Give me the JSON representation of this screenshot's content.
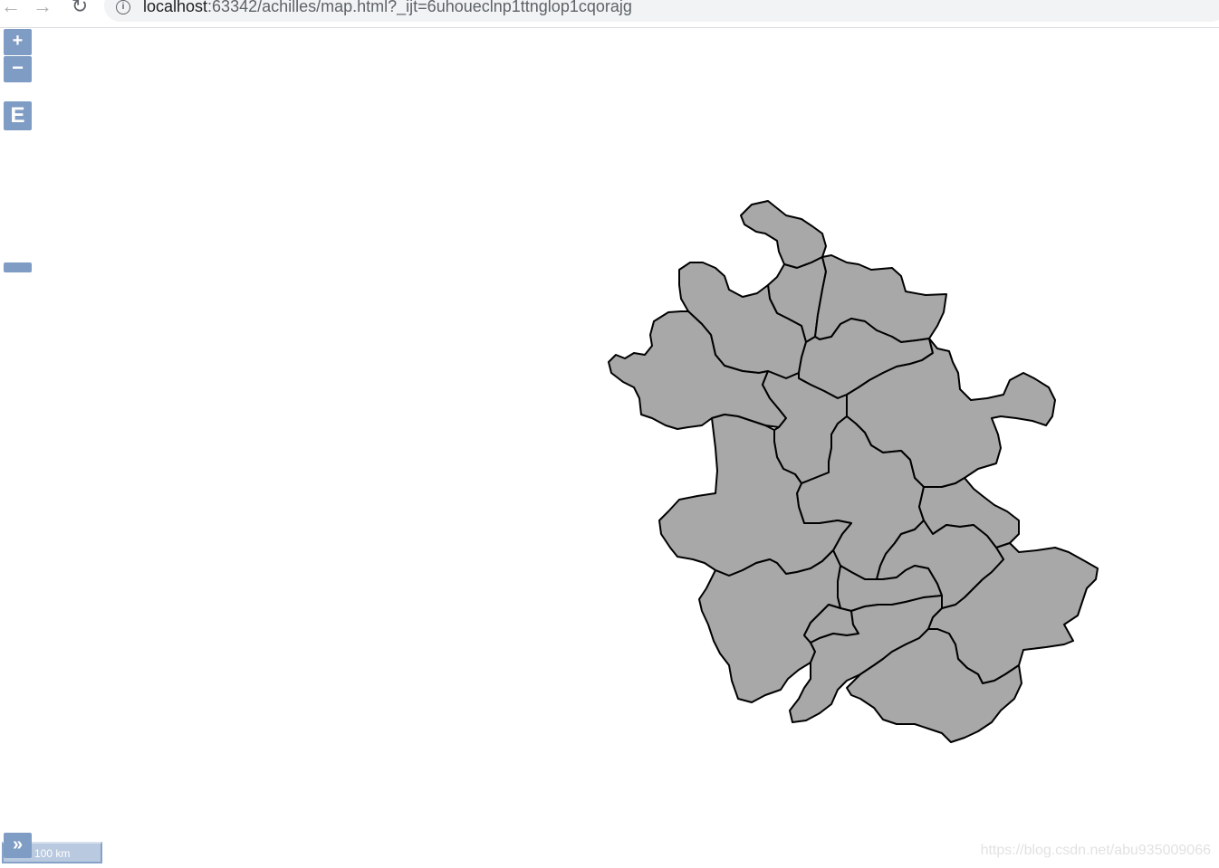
{
  "browser": {
    "back_icon": "arrow-left-icon",
    "forward_icon": "arrow-right-icon",
    "reload_icon": "reload-icon",
    "info_icon": "info-icon",
    "url_host": "localhost",
    "url_rest": ":63342/achilles/map.html?_ijt=6uhoueclnp1ttnglop1cqorajg"
  },
  "map_controls": {
    "zoom_in_label": "+",
    "zoom_out_label": "−",
    "extent_label": "E",
    "expand_label": "»",
    "scale_label": "100 km"
  },
  "map": {
    "fill_color": "#a8a8a8",
    "stroke_color": "#000000",
    "control_color": "#7f9cc4"
  },
  "watermark": "https://blog.csdn.net/abu935009066"
}
